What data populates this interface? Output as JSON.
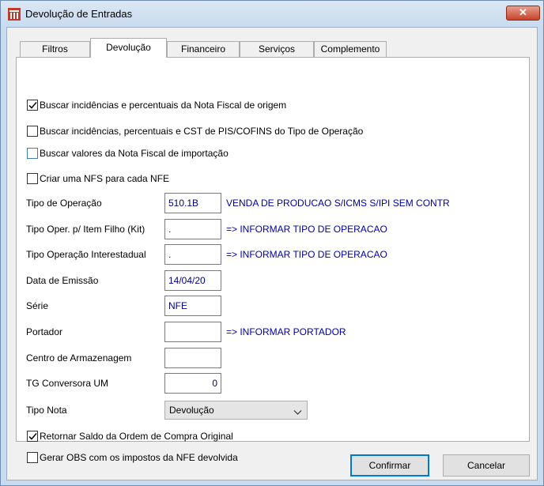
{
  "window": {
    "title": "Devolução de Entradas",
    "close_label": "✕"
  },
  "tabs": [
    {
      "label": "Filtros"
    },
    {
      "label": "Devolução"
    },
    {
      "label": "Financeiro"
    },
    {
      "label": "Serviços"
    },
    {
      "label": "Complemento"
    }
  ],
  "active_tab": "Devolução",
  "checkboxes": [
    {
      "label": "Buscar incidências e percentuais da Nota Fiscal de origem",
      "checked": true
    },
    {
      "label": "Buscar incidências, percentuais e CST de PIS/COFINS do Tipo de Operação",
      "checked": false
    },
    {
      "label": "Buscar valores da Nota Fiscal de importação",
      "checked": false
    },
    {
      "label": "Criar uma NFS para cada NFE",
      "checked": false
    }
  ],
  "fields": {
    "tipo_operacao": {
      "label": "Tipo de Operação",
      "value": "510.1B",
      "desc": "VENDA DE PRODUCAO S/ICMS S/IPI SEM CONTR"
    },
    "tipo_oper_kit": {
      "label": "Tipo Oper. p/ Item Filho (Kit)",
      "value": ".",
      "desc": "=> INFORMAR TIPO DE OPERACAO"
    },
    "tipo_oper_inter": {
      "label": "Tipo Operação Interestadual",
      "value": ".",
      "desc": "=> INFORMAR TIPO DE OPERACAO"
    },
    "data_emissao": {
      "label": "Data de Emissão",
      "value": "14/04/20"
    },
    "serie": {
      "label": "Série",
      "value": "NFE"
    },
    "portador": {
      "label": "Portador",
      "value": "",
      "desc": "=> INFORMAR PORTADOR"
    },
    "centro_armazenagem": {
      "label": "Centro de Armazenagem",
      "value": ""
    },
    "tg_conversora": {
      "label": "TG Conversora UM",
      "value": "0"
    },
    "tipo_nota": {
      "label": "Tipo Nota",
      "value": "Devolução"
    }
  },
  "bottom_checkboxes": [
    {
      "label": "Retornar Saldo da Ordem de Compra Original",
      "checked": true
    },
    {
      "label": "Gerar OBS com os impostos da NFE devolvida",
      "checked": false
    }
  ],
  "buttons": {
    "confirm_label": "Confirmar",
    "cancel_label": "Cancelar"
  },
  "colors": {
    "title_bar": "#c9dbee",
    "value_text": "#000080",
    "desc_text": "#0000a0",
    "close_button": "#c7432a",
    "default_button_border": "#0078d7"
  }
}
